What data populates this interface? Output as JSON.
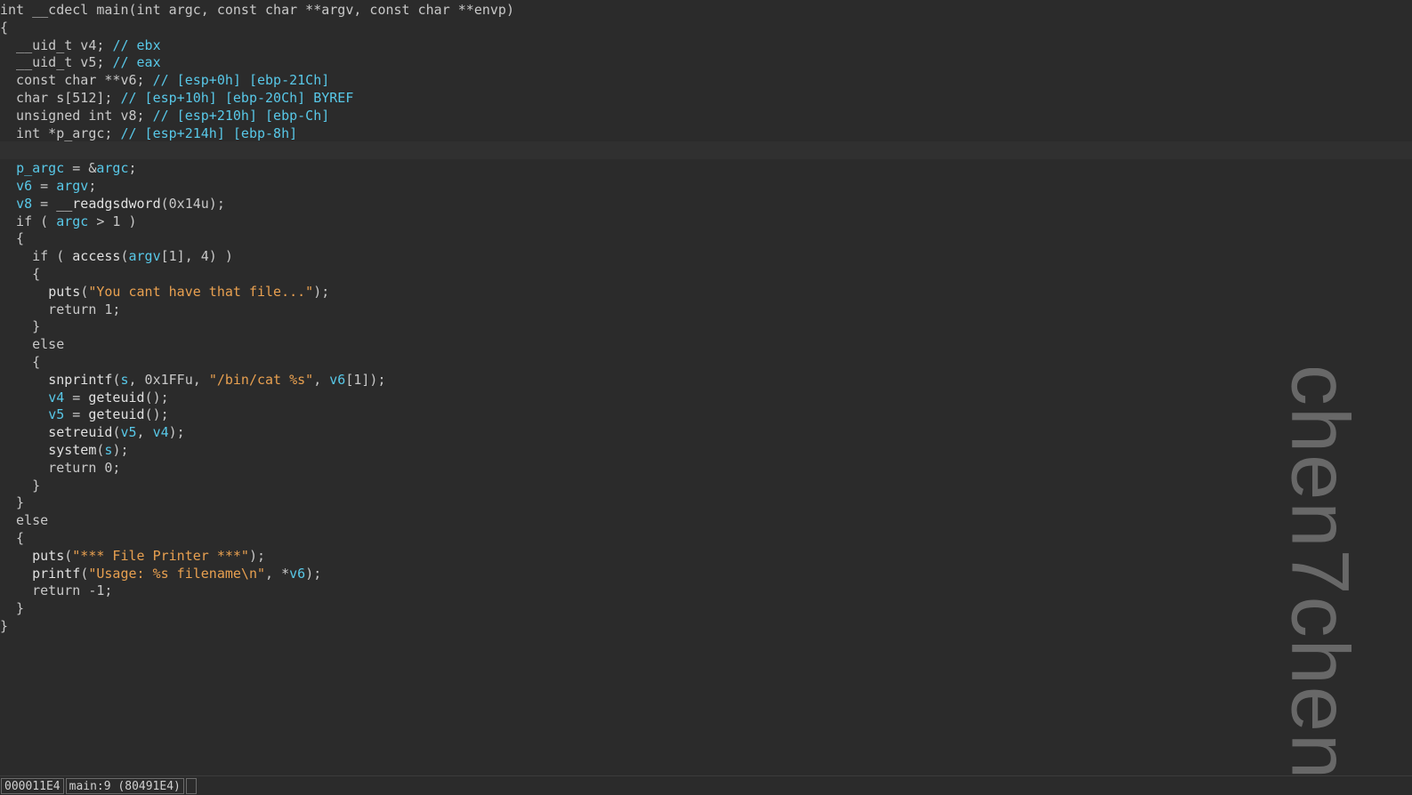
{
  "code_view": {
    "lines": [
      [
        {
          "t": "int __cdecl main(int argc, const char **argv, const char **envp)",
          "c": "plain"
        }
      ],
      [
        {
          "t": "{",
          "c": "plain"
        }
      ],
      [
        {
          "t": "  __uid_t v4; ",
          "c": "plain"
        },
        {
          "t": "// ebx",
          "c": "comment"
        }
      ],
      [
        {
          "t": "  __uid_t v5; ",
          "c": "plain"
        },
        {
          "t": "// eax",
          "c": "comment"
        }
      ],
      [
        {
          "t": "  const char **v6; ",
          "c": "plain"
        },
        {
          "t": "// [esp+0h] [ebp-21Ch]",
          "c": "comment"
        }
      ],
      [
        {
          "t": "  char s[512]; ",
          "c": "plain"
        },
        {
          "t": "// [esp+10h] [ebp-20Ch] BYREF",
          "c": "comment"
        }
      ],
      [
        {
          "t": "  unsigned int v8; ",
          "c": "plain"
        },
        {
          "t": "// [esp+210h] [ebp-Ch]",
          "c": "comment"
        }
      ],
      [
        {
          "t": "  int *p_argc; ",
          "c": "plain"
        },
        {
          "t": "// [esp+214h] [ebp-8h]",
          "c": "comment"
        }
      ],
      [
        {
          "t": "",
          "c": "plain"
        }
      ],
      [
        {
          "t": "  ",
          "c": "plain"
        },
        {
          "t": "p_argc",
          "c": "local"
        },
        {
          "t": " = &",
          "c": "plain"
        },
        {
          "t": "argc",
          "c": "local"
        },
        {
          "t": ";",
          "c": "plain"
        }
      ],
      [
        {
          "t": "  ",
          "c": "plain"
        },
        {
          "t": "v6",
          "c": "local"
        },
        {
          "t": " = ",
          "c": "plain"
        },
        {
          "t": "argv",
          "c": "local"
        },
        {
          "t": ";",
          "c": "plain"
        }
      ],
      [
        {
          "t": "  ",
          "c": "plain"
        },
        {
          "t": "v8",
          "c": "local"
        },
        {
          "t": " = ",
          "c": "plain"
        },
        {
          "t": "__readgsdword",
          "c": "function"
        },
        {
          "t": "(0x14u);",
          "c": "plain"
        }
      ],
      [
        {
          "t": "  if ( ",
          "c": "plain"
        },
        {
          "t": "argc",
          "c": "local"
        },
        {
          "t": " > 1 )",
          "c": "plain"
        }
      ],
      [
        {
          "t": "  {",
          "c": "plain"
        }
      ],
      [
        {
          "t": "    if ( ",
          "c": "plain"
        },
        {
          "t": "access",
          "c": "function"
        },
        {
          "t": "(",
          "c": "plain"
        },
        {
          "t": "argv",
          "c": "local"
        },
        {
          "t": "[1], 4) )",
          "c": "plain"
        }
      ],
      [
        {
          "t": "    {",
          "c": "plain"
        }
      ],
      [
        {
          "t": "      ",
          "c": "plain"
        },
        {
          "t": "puts",
          "c": "function"
        },
        {
          "t": "(",
          "c": "plain"
        },
        {
          "t": "\"You cant have that file...\"",
          "c": "string"
        },
        {
          "t": ");",
          "c": "plain"
        }
      ],
      [
        {
          "t": "      return 1;",
          "c": "plain"
        }
      ],
      [
        {
          "t": "    }",
          "c": "plain"
        }
      ],
      [
        {
          "t": "    else",
          "c": "plain"
        }
      ],
      [
        {
          "t": "    {",
          "c": "plain"
        }
      ],
      [
        {
          "t": "      ",
          "c": "plain"
        },
        {
          "t": "snprintf",
          "c": "function"
        },
        {
          "t": "(",
          "c": "plain"
        },
        {
          "t": "s",
          "c": "local"
        },
        {
          "t": ", 0x1FFu, ",
          "c": "plain"
        },
        {
          "t": "\"/bin/cat %s\"",
          "c": "string"
        },
        {
          "t": ", ",
          "c": "plain"
        },
        {
          "t": "v6",
          "c": "local"
        },
        {
          "t": "[1]);",
          "c": "plain"
        }
      ],
      [
        {
          "t": "      ",
          "c": "plain"
        },
        {
          "t": "v4",
          "c": "local"
        },
        {
          "t": " = ",
          "c": "plain"
        },
        {
          "t": "geteuid",
          "c": "function"
        },
        {
          "t": "();",
          "c": "plain"
        }
      ],
      [
        {
          "t": "      ",
          "c": "plain"
        },
        {
          "t": "v5",
          "c": "local"
        },
        {
          "t": " = ",
          "c": "plain"
        },
        {
          "t": "geteuid",
          "c": "function"
        },
        {
          "t": "();",
          "c": "plain"
        }
      ],
      [
        {
          "t": "      ",
          "c": "plain"
        },
        {
          "t": "setreuid",
          "c": "function"
        },
        {
          "t": "(",
          "c": "plain"
        },
        {
          "t": "v5",
          "c": "local"
        },
        {
          "t": ", ",
          "c": "plain"
        },
        {
          "t": "v4",
          "c": "local"
        },
        {
          "t": ");",
          "c": "plain"
        }
      ],
      [
        {
          "t": "      ",
          "c": "plain"
        },
        {
          "t": "system",
          "c": "function"
        },
        {
          "t": "(",
          "c": "plain"
        },
        {
          "t": "s",
          "c": "local"
        },
        {
          "t": ");",
          "c": "plain"
        }
      ],
      [
        {
          "t": "      return 0;",
          "c": "plain"
        }
      ],
      [
        {
          "t": "    }",
          "c": "plain"
        }
      ],
      [
        {
          "t": "  }",
          "c": "plain"
        }
      ],
      [
        {
          "t": "  else",
          "c": "plain"
        }
      ],
      [
        {
          "t": "  {",
          "c": "plain"
        }
      ],
      [
        {
          "t": "    ",
          "c": "plain"
        },
        {
          "t": "puts",
          "c": "function"
        },
        {
          "t": "(",
          "c": "plain"
        },
        {
          "t": "\"*** File Printer ***\"",
          "c": "string"
        },
        {
          "t": ");",
          "c": "plain"
        }
      ],
      [
        {
          "t": "    ",
          "c": "plain"
        },
        {
          "t": "printf",
          "c": "function"
        },
        {
          "t": "(",
          "c": "plain"
        },
        {
          "t": "\"Usage: %s filename\\n\"",
          "c": "string"
        },
        {
          "t": ", *",
          "c": "plain"
        },
        {
          "t": "v6",
          "c": "local"
        },
        {
          "t": ");",
          "c": "plain"
        }
      ],
      [
        {
          "t": "    return -1;",
          "c": "plain"
        }
      ],
      [
        {
          "t": "  }",
          "c": "plain"
        }
      ],
      [
        {
          "t": "}",
          "c": "plain"
        }
      ]
    ],
    "highlighted_line_index": 8
  },
  "watermark": {
    "text": "chen7chen"
  },
  "status_bar": {
    "address": "000011E4",
    "location": "main:9 (80491E4)"
  },
  "colors": {
    "background": "#2b2b2b",
    "comment": "#58c8e8",
    "string": "#e8a050",
    "plain": "#c8c8c8"
  }
}
